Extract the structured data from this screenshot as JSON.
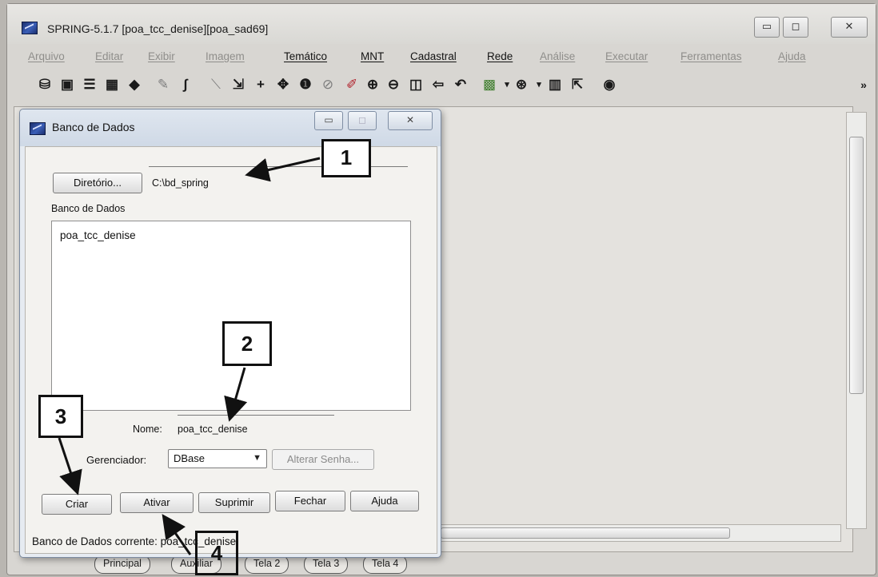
{
  "window": {
    "title": "SPRING-5.1.7 [poa_tcc_denise][poa_sad69]",
    "minimize": "▭",
    "maximize": "◻",
    "close": "✕"
  },
  "menu": [
    "Arquivo",
    "Editar",
    "Exibir",
    "Imagem",
    "Temático",
    "MNT",
    "Cadastral",
    "Rede",
    "Análise",
    "Executar",
    "Ferramentas",
    "Ajuda"
  ],
  "menu_enabled": [
    false,
    false,
    false,
    false,
    true,
    true,
    true,
    true,
    false,
    false,
    false,
    false
  ],
  "toolbar_overflow": "»",
  "dialog": {
    "title": "Banco de Dados",
    "directory_button": "Diretório...",
    "directory_value": "C:\\bd_spring",
    "list_label": "Banco de Dados",
    "list_items": [
      "poa_tcc_denise"
    ],
    "name_label": "Nome:",
    "name_value": "poa_tcc_denise",
    "manager_label": "Gerenciador:",
    "manager_value": "DBase",
    "change_password": "Alterar Senha...",
    "buttons": {
      "create": "Criar",
      "activate": "Ativar",
      "delete": "Suprimir",
      "close": "Fechar",
      "help": "Ajuda"
    },
    "status_text": "Banco de Dados corrente: poa_tcc_denise"
  },
  "bottom_tabs": [
    "Principal",
    "Auxiliar",
    "Tela 2",
    "Tela 3",
    "Tela 4"
  ],
  "callouts": [
    "1",
    "2",
    "3",
    "4"
  ]
}
